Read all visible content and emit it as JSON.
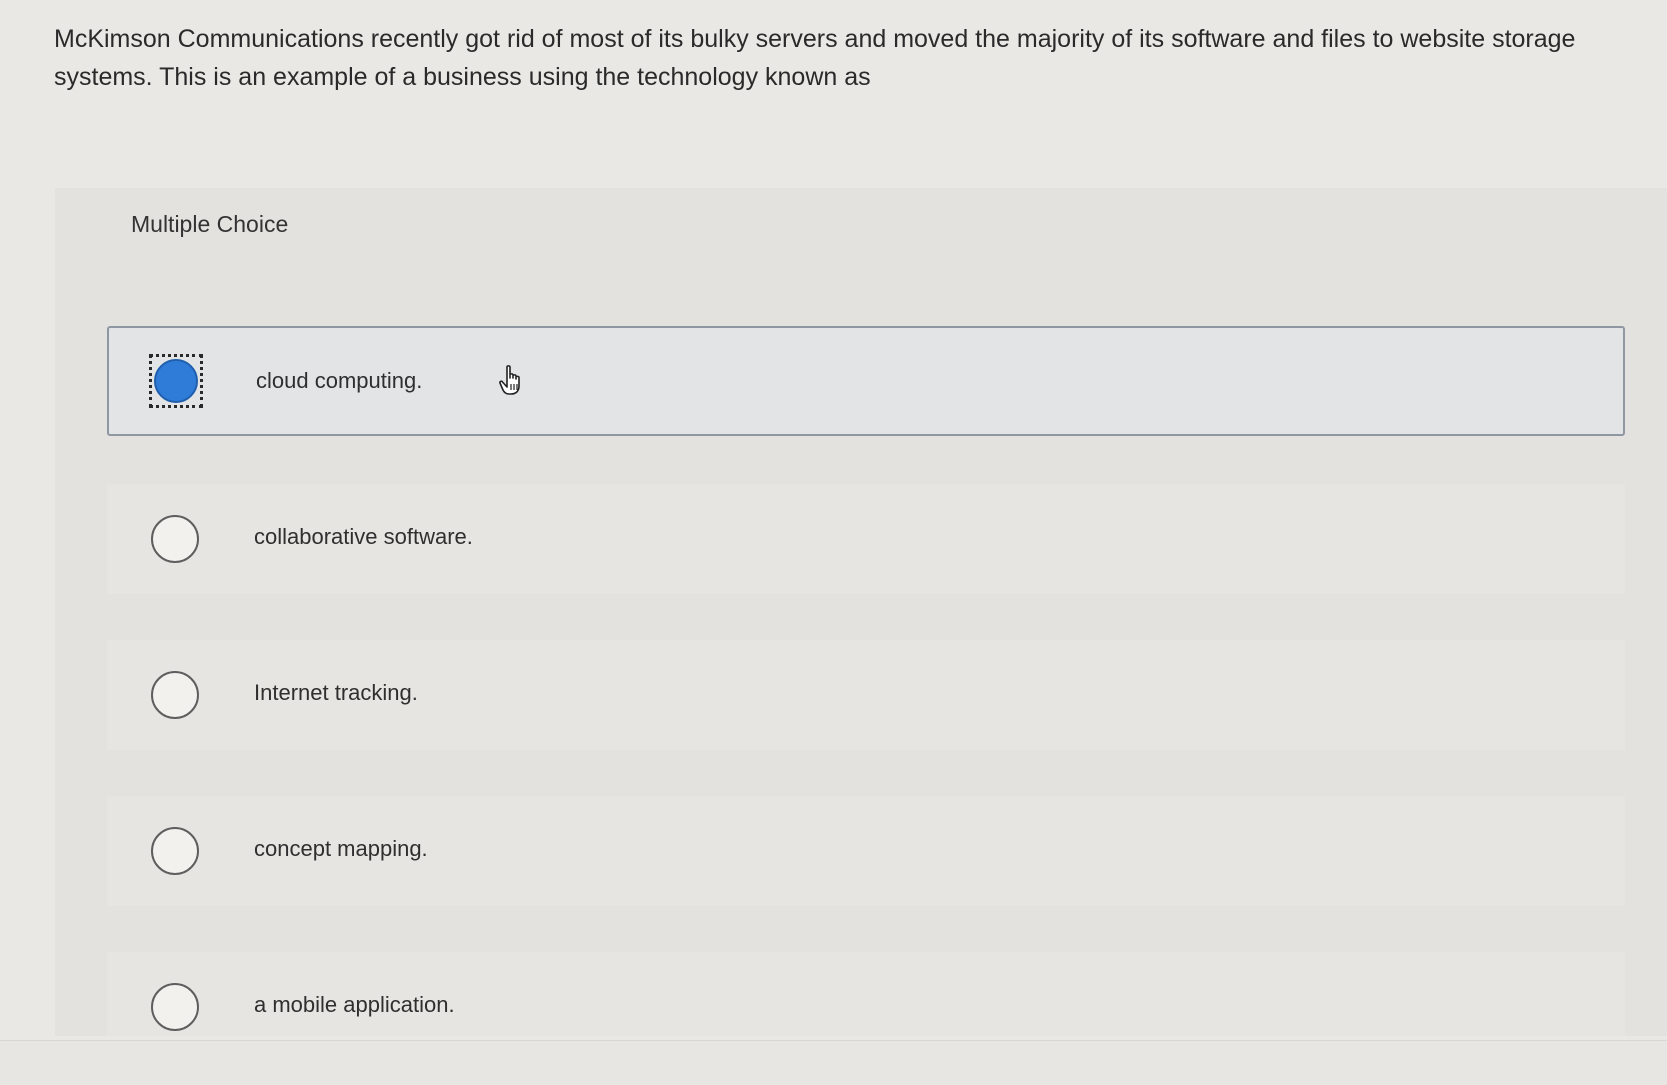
{
  "question": {
    "text": "McKimson Communications recently got rid of most of its bulky servers and moved the majority of its software and files to website storage systems. This is an example of a business using the technology known as"
  },
  "panel": {
    "label": "Multiple Choice"
  },
  "options": [
    {
      "label": "cloud computing.",
      "selected": true
    },
    {
      "label": "collaborative software.",
      "selected": false
    },
    {
      "label": "Internet tracking.",
      "selected": false
    },
    {
      "label": "concept mapping.",
      "selected": false
    },
    {
      "label": "a mobile application.",
      "selected": false
    }
  ],
  "colors": {
    "selected_radio": "#2f7bd8",
    "selected_border": "#8f97a3"
  },
  "icons": {
    "cursor": "hand-pointer-icon"
  }
}
